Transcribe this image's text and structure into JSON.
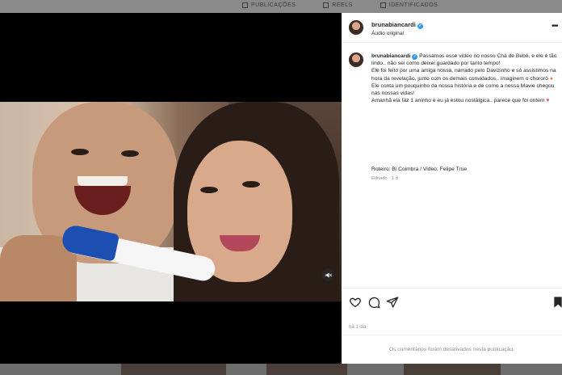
{
  "background_tabs": [
    {
      "label": "PUBLICAÇÕES"
    },
    {
      "label": "REELS"
    },
    {
      "label": "IDENTIFICADOS"
    }
  ],
  "post": {
    "username": "brunabiancardi",
    "audio_label": "Áudio original",
    "caption_lines": [
      "Passamos esse vídeo no nosso Chá de Bebê, e ele é tão lindo.. não sei como deixei guardado por tanto tempo!",
      "Ele foi feito por uma amiga nossa, narrado pelo Davizinho e só assistimos na hora da revelação, junto com os demais convidados.. imaginem o chororô",
      "Ele conta um pouquinho da nossa história e de como a nossa Mavie chegou nas nossas vidas!",
      "Amanhã ela faz 1 aninho e eu já estou nostálgica.. parece que foi ontem"
    ],
    "credits": "Roteiro: Bi Coimbra / Video: Felipe True",
    "edited": "Editado · 1 d",
    "time_ago": "há 1 dia",
    "comments_disabled": "Os comentários foram desativados nesta publicação."
  },
  "icons": {
    "more": "more-options-icon",
    "like": "heart-icon",
    "comment": "comment-icon",
    "share": "send-icon",
    "save": "bookmark-icon",
    "mute": "speaker-muted-icon",
    "verified": "verified-badge-icon"
  },
  "colors": {
    "verified": "#3897f0",
    "text": "#262626",
    "muted": "#8e8e8e",
    "heart": "#ed4956"
  }
}
